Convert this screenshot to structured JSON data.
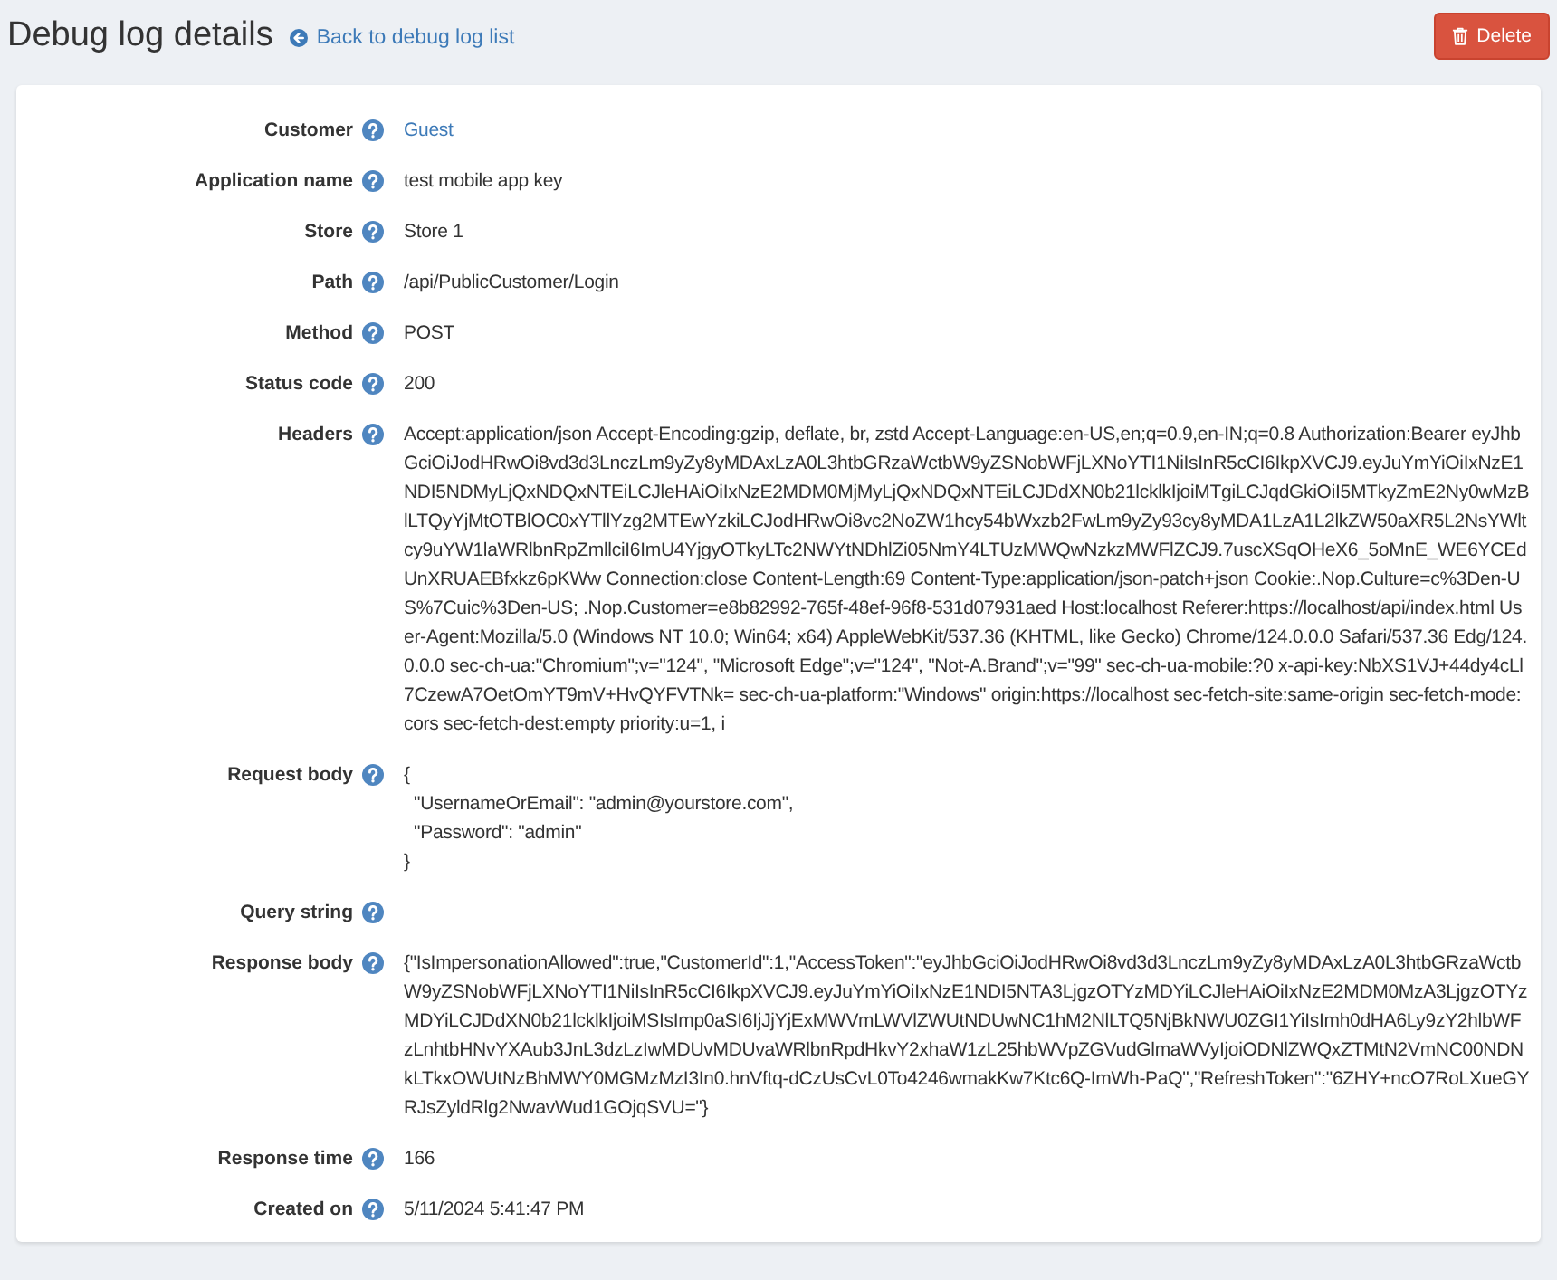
{
  "page": {
    "title": "Debug log details",
    "back_link": "Back to debug log list",
    "delete_button": "Delete"
  },
  "fields": [
    {
      "label": "Customer",
      "kind": "link",
      "value": "Guest"
    },
    {
      "label": "Application name",
      "kind": "text",
      "value": "test mobile app key"
    },
    {
      "label": "Store",
      "kind": "text",
      "value": "Store 1"
    },
    {
      "label": "Path",
      "kind": "text",
      "value": "/api/PublicCustomer/Login"
    },
    {
      "label": "Method",
      "kind": "text",
      "value": "POST"
    },
    {
      "label": "Status code",
      "kind": "text",
      "value": "200"
    },
    {
      "label": "Headers",
      "kind": "text",
      "value": "Accept:application/json Accept-Encoding:gzip, deflate, br, zstd Accept-Language:en-US,en;q=0.9,en-IN;q=0.8 Authorization:Bearer eyJhbGciOiJodHRwOi8vd3d3LnczLm9yZy8yMDAxLzA0L3htbGRzaWctbW9yZSNobWFjLXNoYTI1NiIsInR5cCI6IkpXVCJ9.eyJuYmYiOiIxNzE1NDI5NDMyLjQxNDQxNTEiLCJleHAiOiIxNzE2MDM0MjMyLjQxNDQxNTEiLCJDdXN0b21lcklkIjoiMTgiLCJqdGkiOiI5MTkyZmE2Ny0wMzBlLTQyYjMtOTBlOC0xYTllYzg2MTEwYzkiLCJodHRwOi8vc2NoZW1hcy54bWxzb2FwLm9yZy93cy8yMDA1LzA1L2lkZW50aXR5L2NsYWltcy9uYW1laWRlbnRpZmllciI6ImU4YjgyOTkyLTc2NWYtNDhlZi05NmY4LTUzMWQwNzkzMWFlZCJ9.7uscXSqOHeX6_5oMnE_WE6YCEdUnXRUAEBfxkz6pKWw Connection:close Content-Length:69 Content-Type:application/json-patch+json Cookie:.Nop.Culture=c%3Den-US%7Cuic%3Den-US; .Nop.Customer=e8b82992-765f-48ef-96f8-531d07931aed Host:localhost Referer:https://localhost/api/index.html User-Agent:Mozilla/5.0 (Windows NT 10.0; Win64; x64) AppleWebKit/537.36 (KHTML, like Gecko) Chrome/124.0.0.0 Safari/537.36 Edg/124.0.0.0 sec-ch-ua:\"Chromium\";v=\"124\", \"Microsoft Edge\";v=\"124\", \"Not-A.Brand\";v=\"99\" sec-ch-ua-mobile:?0 x-api-key:NbXS1VJ+44dy4cLl7CzewA7OetOmYT9mV+HvQYFVTNk= sec-ch-ua-platform:\"Windows\" origin:https://localhost sec-fetch-site:same-origin sec-fetch-mode:cors sec-fetch-dest:empty priority:u=1, i"
    },
    {
      "label": "Request body",
      "kind": "code",
      "value": "{\n  \"UsernameOrEmail\": \"admin@yourstore.com\",\n  \"Password\": \"admin\"\n}"
    },
    {
      "label": "Query string",
      "kind": "text"
    },
    {
      "label": "Response body",
      "kind": "text",
      "value": "{\"IsImpersonationAllowed\":true,\"CustomerId\":1,\"AccessToken\":\"eyJhbGciOiJodHRwOi8vd3d3LnczLm9yZy8yMDAxLzA0L3htbGRzaWctbW9yZSNobWFjLXNoYTI1NiIsInR5cCI6IkpXVCJ9.eyJuYmYiOiIxNzE1NDI5NTA3LjgzOTYzMDYiLCJleHAiOiIxNzE2MDM0MzA3LjgzOTYzMDYiLCJDdXN0b21lcklkIjoiMSIsImp0aSI6IjJjYjExMWVmLWVlZWUtNDUwNC1hM2NlLTQ5NjBkNWU0ZGI1YiIsImh0dHA6Ly9zY2hlbWFzLnhtbHNvYXAub3JnL3dzLzIwMDUvMDUvaWRlbnRpdHkvY2xhaW1zL25hbWVpZGVudGlmaWVyIjoiODNlZWQxZTMtN2VmNC00NDNkLTkxOWUtNzBhMWY0MGMzMzI3In0.hnVftq-dCzUsCvL0To4246wmakKw7Ktc6Q-ImWh-PaQ\",\"RefreshToken\":\"6ZHY+ncO7RoLXueGYRJsZyldRlg2NwavWud1GOjqSVU=\"}"
    },
    {
      "label": "Response time",
      "kind": "text",
      "value": "166"
    },
    {
      "label": "Created on",
      "kind": "text",
      "value": "5/11/2024 5:41:47 PM"
    }
  ]
}
